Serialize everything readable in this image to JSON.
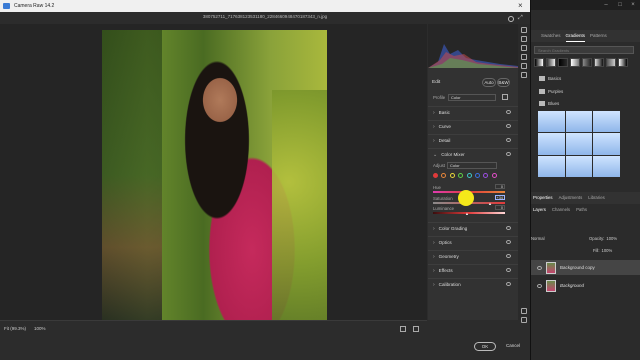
{
  "dialog": {
    "title": "Camera Raw 14.2",
    "filename": "380752711_717638123531180_2284660948470187343_n.jpg",
    "fit_label": "Fit (99.3%)",
    "zoom_value": "100%",
    "ok_label": "OK",
    "cancel_label": "Cancel"
  },
  "panel": {
    "edit_label": "Edit",
    "auto_label": "Auto",
    "bw_label": "B&W",
    "profile_label": "Profile",
    "profile_value": "Color",
    "sections_top": [
      "Basic",
      "Curve",
      "Detail"
    ],
    "color_mixer": {
      "title": "Color Mixer",
      "adjust_label": "Adjust",
      "adjust_value": "Color",
      "dot_colors": [
        "#e03b3b",
        "#e8863a",
        "#e6d43a",
        "#5fcf48",
        "#3ec7c7",
        "#3a6fe0",
        "#9a4ee0",
        "#e04ec6"
      ],
      "hue_label": "Hue",
      "hue_value": "0",
      "saturation_label": "Saturation",
      "saturation_value": "+34",
      "luminance_label": "Luminance",
      "luminance_value": "0"
    },
    "sections_bottom": [
      "Color Grading",
      "Optics",
      "Geometry",
      "Effects",
      "Calibration"
    ]
  },
  "photoshop": {
    "tabs": [
      "Swatches",
      "Gradients",
      "Patterns"
    ],
    "active_tab": "Gradients",
    "search_placeholder": "Search Gradients",
    "folders": [
      "Basics",
      "Purples",
      "Blues"
    ],
    "layer_tabs": [
      "Properties",
      "Adjustments",
      "Libraries"
    ],
    "layer_subtabs": [
      "Layers",
      "Channels",
      "Paths"
    ],
    "mode_value": "Normal",
    "opacity_label": "Opacity:",
    "opacity_value": "100%",
    "fill_label": "Fill:",
    "fill_value": "100%",
    "layers": [
      "Background copy",
      "Background"
    ]
  }
}
